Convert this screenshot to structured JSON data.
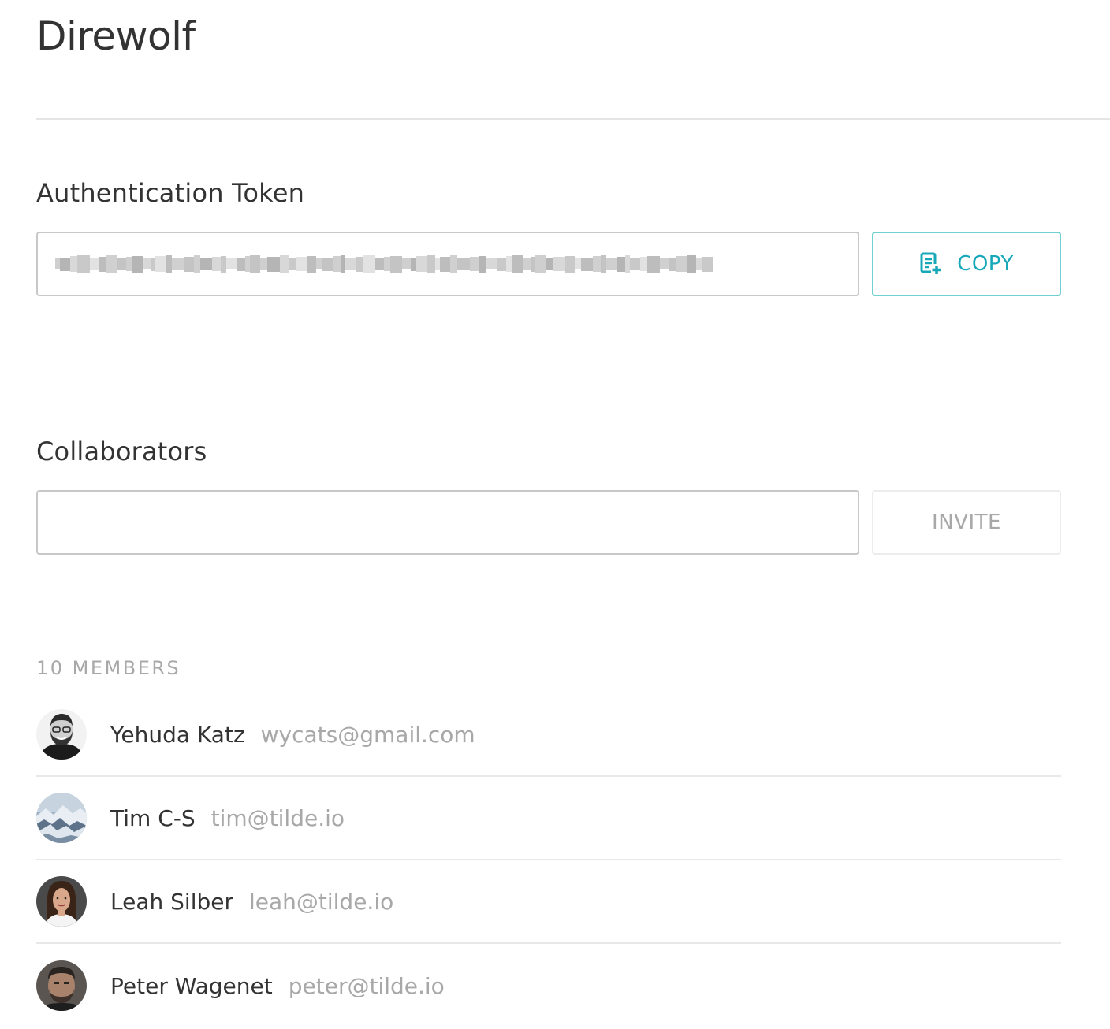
{
  "header": {
    "title": "Direwolf"
  },
  "auth_token": {
    "heading": "Authentication Token",
    "value": "",
    "copy_label": "COPY",
    "accent_color": "#16a8b8"
  },
  "collaborators": {
    "heading": "Collaborators",
    "input_value": "",
    "invite_label": "INVITE"
  },
  "members": {
    "count_label": "10 MEMBERS",
    "list": [
      {
        "name": "Yehuda Katz",
        "email": "wycats@gmail.com",
        "avatar": "avatar-bearded-man"
      },
      {
        "name": "Tim C-S",
        "email": "tim@tilde.io",
        "avatar": "avatar-mountain-landscape"
      },
      {
        "name": "Leah Silber",
        "email": "leah@tilde.io",
        "avatar": "avatar-woman"
      },
      {
        "name": "Peter Wagenet",
        "email": "peter@tilde.io",
        "avatar": "avatar-man"
      }
    ]
  }
}
